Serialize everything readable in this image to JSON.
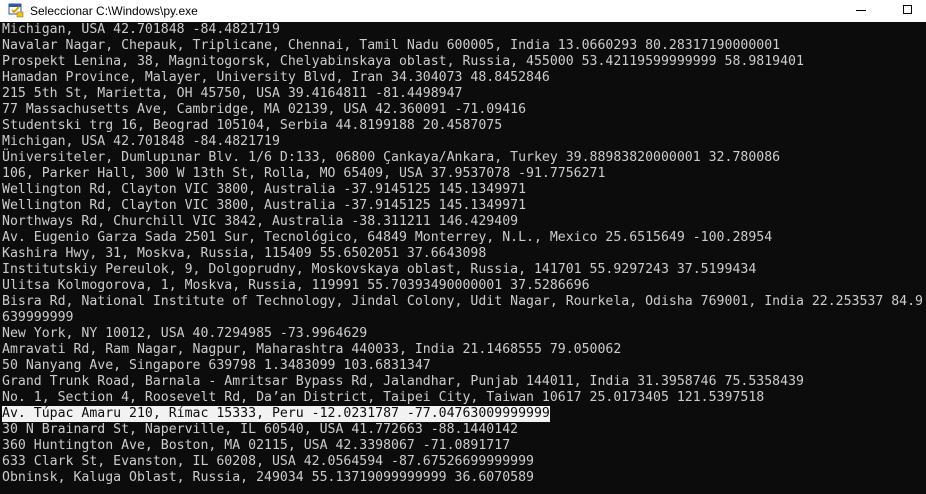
{
  "window": {
    "title": "Seleccionar C:\\Windows\\py.exe",
    "icon": "python-launcher-icon",
    "colors": {
      "console_bg": "#0c0c0c",
      "console_fg": "#cccccc",
      "selection_bg": "#f2f2f2",
      "titlebar_bg": "#ffffff"
    }
  },
  "console": {
    "lines": [
      "Michigan, USA 42.701848 -84.4821719",
      "Navalar Nagar, Chepauk, Triplicane, Chennai, Tamil Nadu 600005, India 13.0660293 80.28317190000001",
      "Prospekt Lenina, 38, Magnitogorsk, Chelyabinskaya oblast, Russia, 455000 53.42119599999999 58.9819401",
      "Hamadan Province, Malayer, University Blvd, Iran 34.304073 48.8452846",
      "215 5th St, Marietta, OH 45750, USA 39.4164811 -81.4498947",
      "77 Massachusetts Ave, Cambridge, MA 02139, USA 42.360091 -71.09416",
      "Studentski trg 16, Beograd 105104, Serbia 44.8199188 20.4587075",
      "Michigan, USA 42.701848 -84.4821719",
      "Üniversiteler, Dumlupınar Blv. 1/6 D:133, 06800 Çankaya/Ankara, Turkey 39.88983820000001 32.780086",
      "106, Parker Hall, 300 W 13th St, Rolla, MO 65409, USA 37.9537078 -91.7756271",
      "Wellington Rd, Clayton VIC 3800, Australia -37.9145125 145.1349971",
      "Wellington Rd, Clayton VIC 3800, Australia -37.9145125 145.1349971",
      "Northways Rd, Churchill VIC 3842, Australia -38.311211 146.429409",
      "Av. Eugenio Garza Sada 2501 Sur, Tecnológico, 64849 Monterrey, N.L., Mexico 25.6515649 -100.28954",
      "Kashira Hwy, 31, Moskva, Russia, 115409 55.6502051 37.6643098",
      "Institutskiy Pereulok, 9, Dolgoprudny, Moskovskaya oblast, Russia, 141701 55.9297243 37.5199434",
      "Ulitsa Kolmogorova, 1, Moskva, Russia, 119991 55.70393490000001 37.5286696",
      "Bisra Rd, National Institute of Technology, Jindal Colony, Udit Nagar, Rourkela, Odisha 769001, India 22.253537 84.9",
      "639999999",
      "New York, NY 10012, USA 40.7294985 -73.9964629",
      "Amravati Rd, Ram Nagar, Nagpur, Maharashtra 440033, India 21.1468555 79.050062",
      "50 Nanyang Ave, Singapore 639798 1.3483099 103.6831347",
      "Grand Trunk Road, Barnala - Amritsar Bypass Rd, Jalandhar, Punjab 144011, India 31.3958746 75.5358439",
      "No. 1, Section 4, Roosevelt Rd, Da’an District, Taipei City, Taiwan 10617 25.0173405 121.5397518",
      "Av. Túpac Amaru 210, Rímac 15333, Peru -12.0231787 -77.04763009999999",
      "30 N Brainard St, Naperville, IL 60540, USA 41.772663 -88.1440142",
      "360 Huntington Ave, Boston, MA 02115, USA 42.3398067 -71.0891717",
      "633 Clark St, Evanston, IL 60208, USA 42.0564594 -87.67526699999999",
      "Obninsk, Kaluga Oblast, Russia, 249034 55.13719099999999 36.6070589"
    ],
    "selected_line_index": 24
  }
}
